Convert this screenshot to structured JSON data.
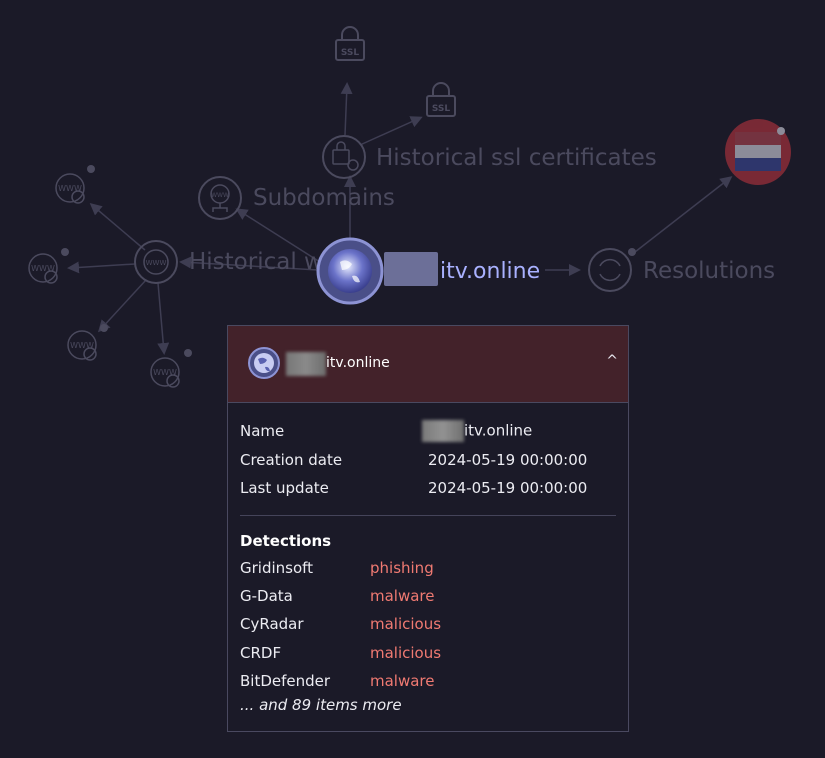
{
  "graph": {
    "labels": {
      "historical_ssl": "Historical ssl certificates",
      "subdomains": "Subdomains",
      "historical_whois": "Historical w",
      "resolutions": "Resolutions",
      "main_domain": "itv.online"
    },
    "icons": {
      "ssl": "SSL",
      "www": "WWW"
    }
  },
  "panel": {
    "title": "itv.online",
    "collapse_icon": "^",
    "fields": [
      {
        "label": "Name",
        "value": "itv.online"
      },
      {
        "label": "Creation date",
        "value": "2024-05-19 00:00:00"
      },
      {
        "label": "Last update",
        "value": "2024-05-19 00:00:00"
      }
    ],
    "detections_title": "Detections",
    "detections": [
      {
        "engine": "Gridinsoft",
        "result": "phishing"
      },
      {
        "engine": "G-Data",
        "result": "malware"
      },
      {
        "engine": "CyRadar",
        "result": "malicious"
      },
      {
        "engine": "CRDF",
        "result": "malicious"
      },
      {
        "engine": "BitDefender",
        "result": "malware"
      }
    ],
    "more_text": "... and 89 items more"
  },
  "colors": {
    "background": "#1b1a28",
    "panel_header": "#43222a",
    "detection_red": "#f07a72",
    "main_label": "#a9b1ff",
    "dim_node": "#4b4a5e"
  }
}
